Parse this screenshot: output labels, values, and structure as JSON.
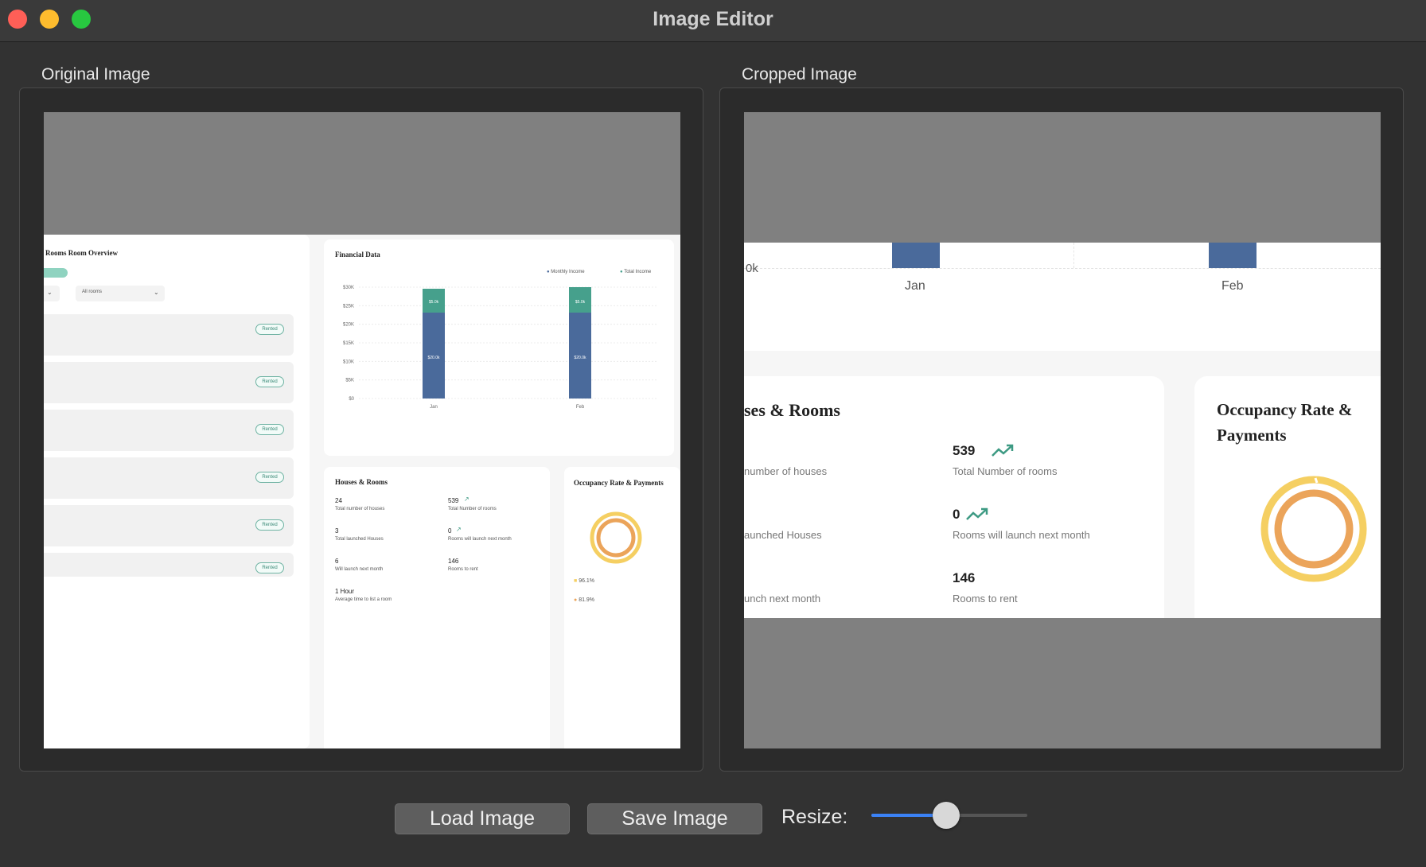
{
  "window": {
    "title": "Image Editor"
  },
  "panels": {
    "original_label": "Original Image",
    "cropped_label": "Cropped Image"
  },
  "controls": {
    "load_label": "Load Image",
    "save_label": "Save Image",
    "resize_label": "Resize:",
    "resize_value": 0.48
  },
  "original_preview": {
    "left_title": "Rooms Room Overview",
    "filter_label": "All rooms",
    "financial_title": "Financial Data",
    "legend": [
      "Monthly Income",
      "Total Income"
    ],
    "y_ticks": [
      "$30K",
      "$25K",
      "$20K",
      "$15K",
      "$10K",
      "$5K",
      "$0"
    ],
    "months": [
      "Jan",
      "Feb"
    ],
    "bar_top_label": "$5.0k",
    "bar_main_label": "$20.0k",
    "houses_title": "Houses & Rooms",
    "stats": [
      {
        "value": "24",
        "label": "Total number of houses"
      },
      {
        "value": "539",
        "label": "Total Number of rooms"
      },
      {
        "value": "3",
        "label": "Total launched Houses"
      },
      {
        "value": "0",
        "label": "Rooms will launch next month"
      },
      {
        "value": "6",
        "label": "Will launch next month"
      },
      {
        "value": "146",
        "label": "Rooms to rent"
      },
      {
        "value": "1 Hour",
        "label": "Average time to list a room"
      }
    ],
    "occupancy_title": "Occupancy Rate & Payments",
    "occ_legend": [
      "96.1%",
      "81.9%"
    ],
    "status_pill": "Rented"
  },
  "cropped_preview": {
    "axis_zero": "0k",
    "months": [
      "Jan",
      "Feb"
    ],
    "houses_title": "ses & Rooms",
    "occupancy_title_1": "Occupancy Rate &",
    "occupancy_title_2": "Payments",
    "stats": [
      {
        "value": "539",
        "label": "Total Number of rooms"
      },
      {
        "value": "0",
        "label": "Rooms will launch next month"
      },
      {
        "value": "146",
        "label": "Rooms to rent"
      }
    ],
    "left_labels": [
      "number of houses",
      "aunched Houses",
      "unch next month"
    ]
  },
  "colors": {
    "bar_blue": "#4a6a9b",
    "bar_teal": "#46a08c",
    "ring_yellow": "#f5cf62",
    "ring_orange": "#eba45a",
    "trend_green": "#3d9a83"
  }
}
